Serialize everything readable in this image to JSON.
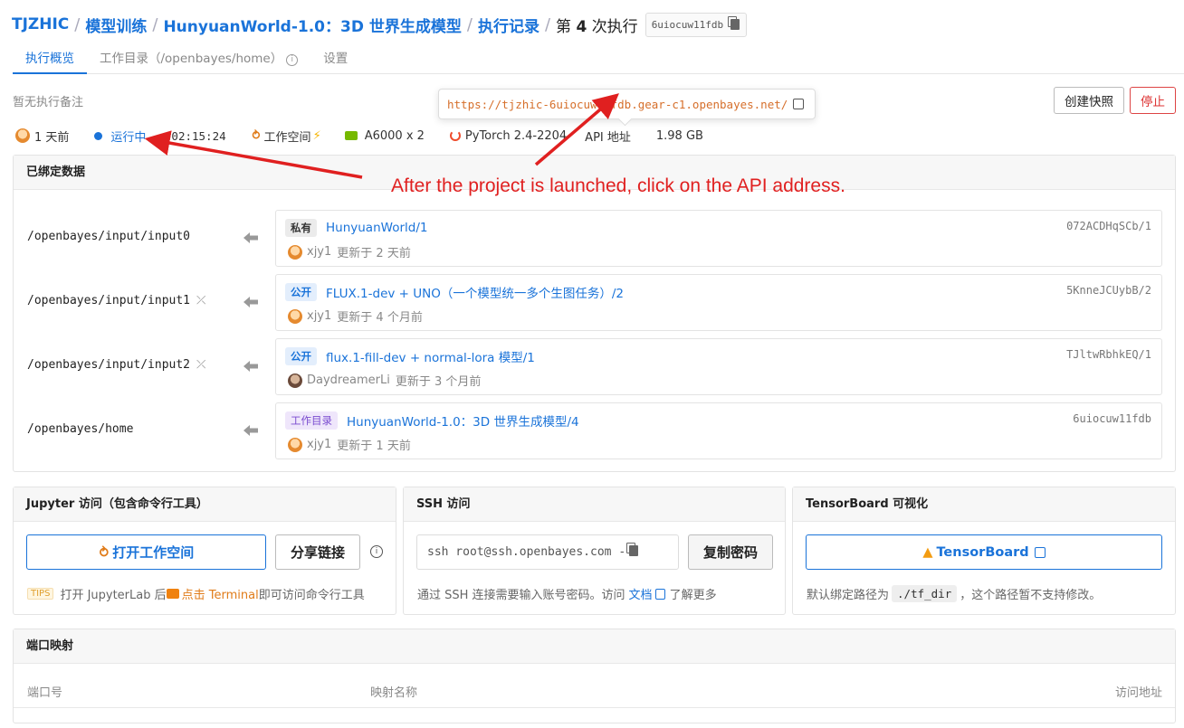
{
  "breadcrumb": {
    "items": [
      "TJZHIC",
      "模型训练",
      "HunyuanWorld-1.0：3D 世界生成模型",
      "执行记录"
    ],
    "current_prefix": "第",
    "current_number": "4",
    "current_suffix": "次执行",
    "hash": "6uiocuw11fdb"
  },
  "tabs": [
    {
      "label": "执行概览"
    },
    {
      "label": "工作目录（/openbayes/home）"
    },
    {
      "label": "设置"
    }
  ],
  "note": "暂无执行备注",
  "actions": {
    "snapshot": "创建快照",
    "stop": "停止"
  },
  "popup_url": "https://tjzhic-6uiocuw11fdb.gear-c1.openbayes.net/",
  "status": {
    "time_ago": "1 天前",
    "state": "运行中",
    "duration": "02:15:24",
    "workspace": "工作空间",
    "gpu": "A6000 x 2",
    "framework": "PyTorch 2.4-2204",
    "api": "API 地址",
    "size": "1.98 GB"
  },
  "bound": {
    "title": "已绑定数据",
    "rows": [
      {
        "path": "/openbayes/input/input0",
        "tag": "私有",
        "name": "HunyuanWorld/1",
        "user": "xjy1",
        "updated": "更新于 2 天前",
        "hash": "072ACDHqSCb/1"
      },
      {
        "path": "/openbayes/input/input1",
        "tag": "公开",
        "name": "FLUX.1-dev + UNO（一个模型统一多个生图任务）/2",
        "user": "xjy1",
        "updated": "更新于 4 个月前",
        "hash": "5KnneJCUybB/2"
      },
      {
        "path": "/openbayes/input/input2",
        "tag": "公开",
        "name": "flux.1-fill-dev + normal-lora 模型/1",
        "user": "DaydreamerLi",
        "updated": "更新于 3 个月前",
        "hash": "TJltwRbhkEQ/1"
      },
      {
        "path": "/openbayes/home",
        "tag": "工作目录",
        "name": "HunyuanWorld-1.0：3D 世界生成模型/4",
        "user": "xjy1",
        "updated": "更新于 1 天前",
        "hash": "6uiocuw11fdb"
      }
    ]
  },
  "jupyter": {
    "title": "Jupyter 访问（包含命令行工具）",
    "open": "打开工作空间",
    "share": "分享链接",
    "tip_badge": "TIPS",
    "tip_a": "打开 JupyterLab 后",
    "tip_b": "点击 Terminal",
    "tip_c": "即可访问命令行工具"
  },
  "ssh": {
    "title": "SSH 访问",
    "command": "ssh root@ssh.openbayes.com -",
    "copy_pw": "复制密码",
    "desc_a": "通过 SSH 连接需要输入账号密码。访问",
    "doc": "文档",
    "desc_b": "了解更多"
  },
  "tensorboard": {
    "title": "TensorBoard 可视化",
    "button": "TensorBoard",
    "desc_a": "默认绑定路径为",
    "path": "./tf_dir",
    "desc_b": "，这个路径暂不支持修改。"
  },
  "port": {
    "title": "端口映射",
    "columns": [
      "端口号",
      "映射名称",
      "访问地址"
    ]
  },
  "annotation": "After the project is launched, click on the API address.",
  "colors": {
    "accent": "#1a73d9",
    "annotation": "#e02020",
    "workspace": "#e07b18"
  }
}
